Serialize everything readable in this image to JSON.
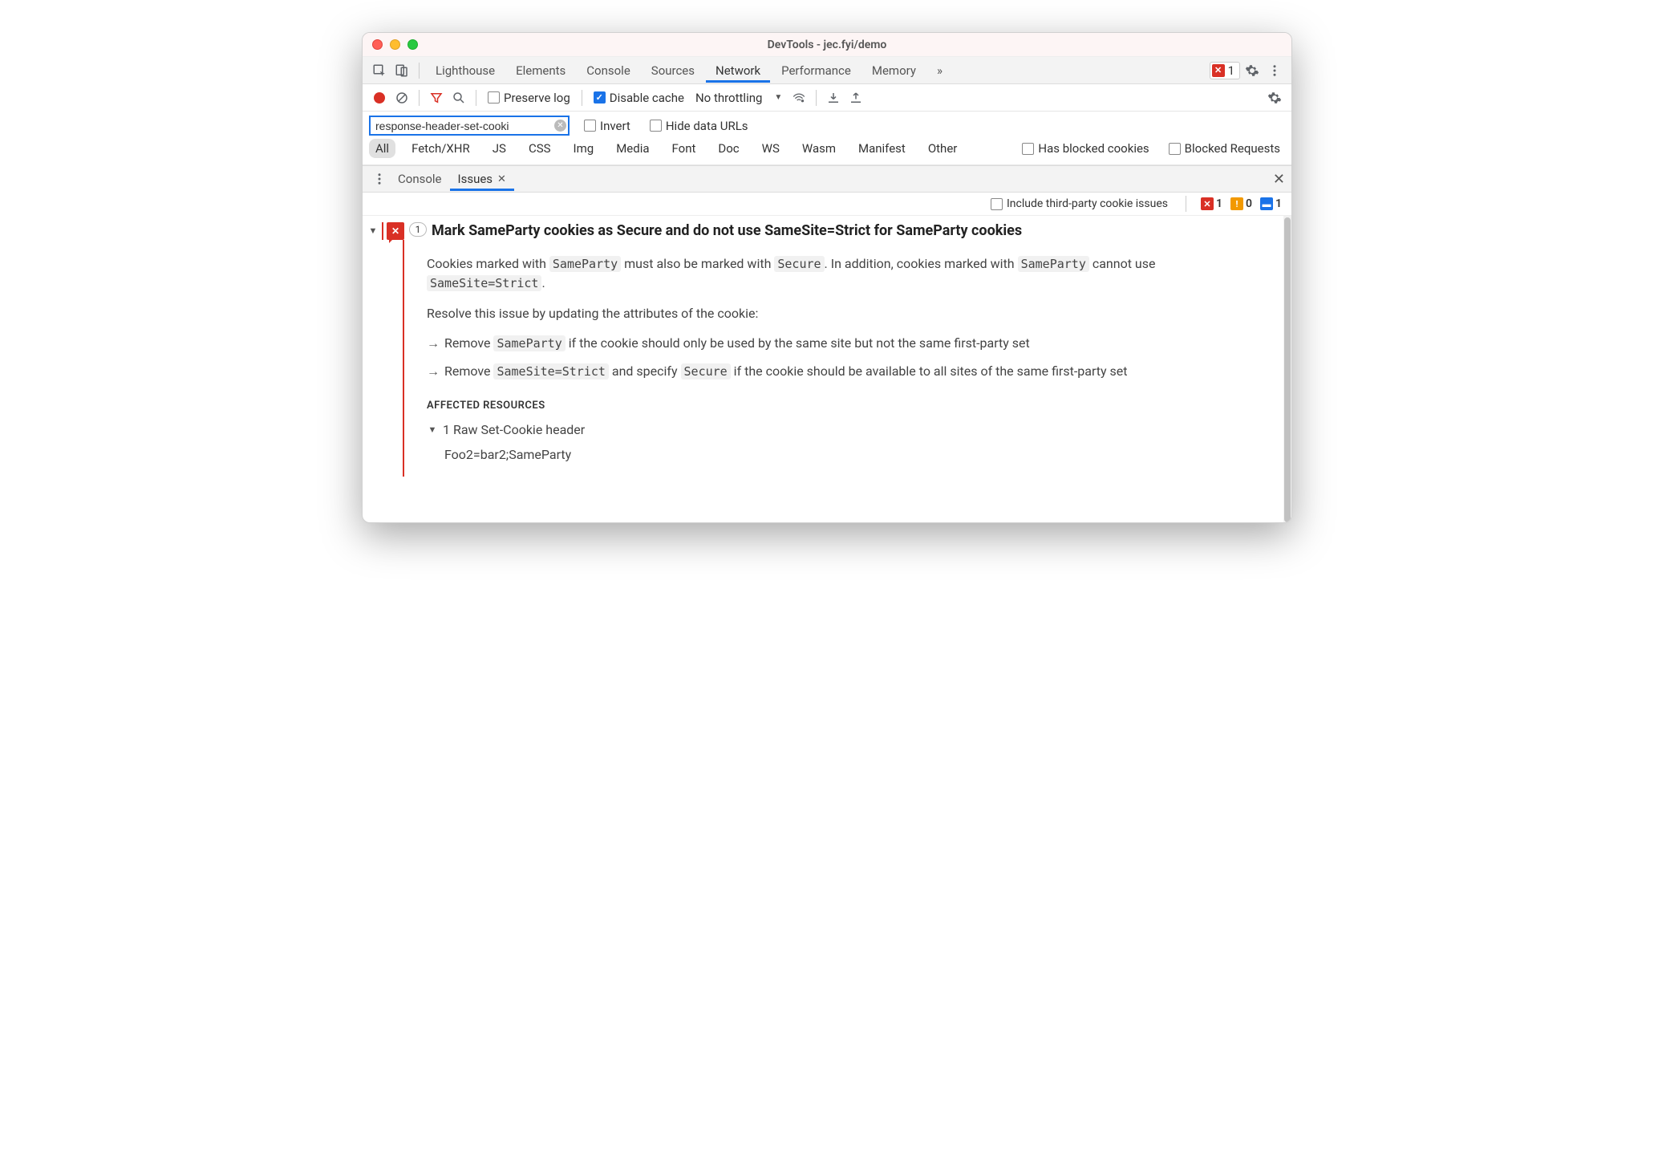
{
  "window": {
    "title": "DevTools - jec.fyi/demo"
  },
  "main_tabs": {
    "items": [
      "Lighthouse",
      "Elements",
      "Console",
      "Sources",
      "Network",
      "Performance",
      "Memory"
    ],
    "active": "Network",
    "overflow": "»",
    "error_count": "1"
  },
  "network_toolbar": {
    "preserve_log": "Preserve log",
    "disable_cache": "Disable cache",
    "throttling": "No throttling"
  },
  "filter": {
    "value": "response-header-set-cooki",
    "invert": "Invert",
    "hide_data_urls": "Hide data URLs"
  },
  "types": {
    "items": [
      "All",
      "Fetch/XHR",
      "JS",
      "CSS",
      "Img",
      "Media",
      "Font",
      "Doc",
      "WS",
      "Wasm",
      "Manifest",
      "Other"
    ],
    "active": "All",
    "has_blocked": "Has blocked cookies",
    "blocked_requests": "Blocked Requests"
  },
  "drawer": {
    "tabs": [
      "Console",
      "Issues"
    ],
    "active": "Issues"
  },
  "issues_toolbar": {
    "include_third_party": "Include third-party cookie issues",
    "counts": {
      "error": "1",
      "warning": "0",
      "info": "1"
    }
  },
  "issue": {
    "count": "1",
    "title": "Mark SameParty cookies as Secure and do not use SameSite=Strict for SameParty cookies",
    "p1_a": "Cookies marked with ",
    "p1_code1": "SameParty",
    "p1_b": " must also be marked with ",
    "p1_code2": "Secure",
    "p1_c": ". In addition, cookies marked with ",
    "p1_code3": "SameParty",
    "p1_d": " cannot use ",
    "p1_code4": "SameSite=Strict",
    "p1_e": ".",
    "p2": "Resolve this issue by updating the attributes of the cookie:",
    "b1_a": "Remove ",
    "b1_code": "SameParty",
    "b1_b": " if the cookie should only be used by the same site but not the same first-party set",
    "b2_a": "Remove ",
    "b2_code1": "SameSite=Strict",
    "b2_b": " and specify ",
    "b2_code2": "Secure",
    "b2_c": " if the cookie should be available to all sites of the same first-party set",
    "affected_heading": "AFFECTED RESOURCES",
    "raw_header_label": "1 Raw Set-Cookie header",
    "raw_header_value": "Foo2=bar2;SameParty"
  }
}
